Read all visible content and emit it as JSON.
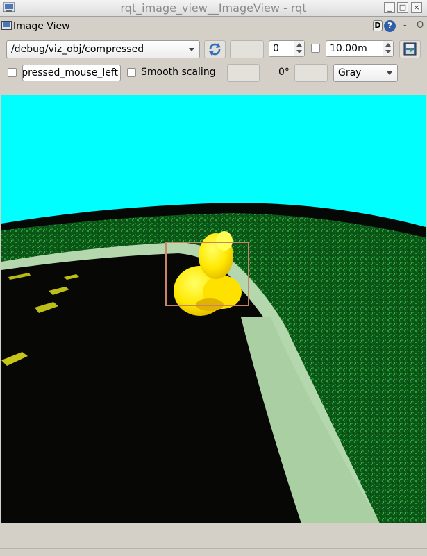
{
  "window": {
    "title": "rqt_image_view__ImageView - rqt"
  },
  "plugin": {
    "title": "Image View",
    "d_label": "D",
    "help_label": "?",
    "close_label": "-",
    "dock_label": "O"
  },
  "toolbar": {
    "topic": "/debug/viz_obj/compressed",
    "spin_value": "0",
    "timeout_value": "10.00m",
    "mouse_topic": "/debug/viz_obj/compressed_mouse_left",
    "smooth_scaling_label": "Smooth scaling",
    "rotation_label": "0°",
    "colormap": "Gray"
  },
  "image": {
    "description_colors": {
      "sky": "#00ffff",
      "grass": "#0f6d1c",
      "road": "#0a0a08",
      "lane": "#c2e3b7",
      "duck": "#ffee12",
      "bbox": "#c98367"
    }
  }
}
